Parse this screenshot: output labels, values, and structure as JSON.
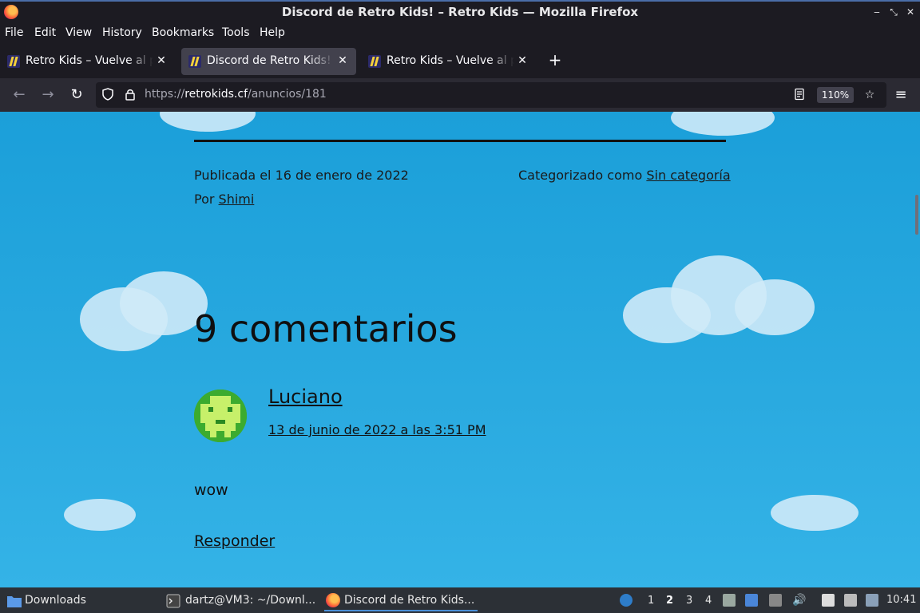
{
  "window": {
    "title": "Discord de Retro Kids! – Retro Kids — Mozilla Firefox"
  },
  "menu": {
    "file": "File",
    "edit": "Edit",
    "view": "View",
    "history": "History",
    "bookmarks": "Bookmarks",
    "tools": "Tools",
    "help": "Help"
  },
  "tabs": [
    {
      "label": "Retro Kids – Vuelve al pasado"
    },
    {
      "label": "Discord de Retro Kids! – Retro Kids"
    },
    {
      "label": "Retro Kids – Vuelve al pasado"
    }
  ],
  "url": {
    "scheme": "https://",
    "host": "retrokids.cf",
    "path": "/anuncios/181"
  },
  "zoom": "110%",
  "post": {
    "published": "Publicada el 16 de enero de 2022",
    "by_prefix": "Por",
    "author": "Shimi",
    "category_prefix": "Categorizado como",
    "category": "Sin categoría"
  },
  "comments": {
    "heading": "9 comentarios",
    "first": {
      "author": "Luciano",
      "date": "13 de junio de 2022 a las 3:51 PM",
      "text": "wow",
      "reply": "Responder"
    }
  },
  "taskbar": {
    "downloads": "Downloads",
    "terminal": "dartz@VM3: ~/Downl...",
    "firefox": "Discord de Retro Kids...",
    "workspaces": [
      "1",
      "2",
      "3",
      "4"
    ],
    "current_workspace": "2",
    "clock": "10:41"
  },
  "colors": {
    "page_bg": "#1b9fd9",
    "chrome_bg": "#1c1b22",
    "active_tab": "#42414d"
  }
}
